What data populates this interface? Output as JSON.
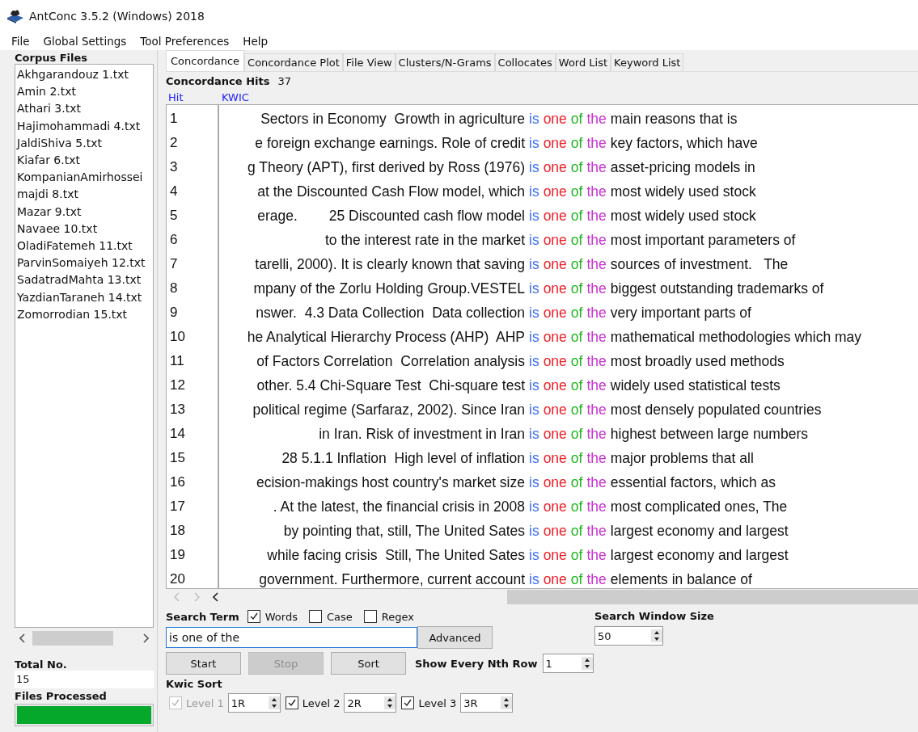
{
  "window": {
    "title": "AntConc 3.5.2 (Windows) 2018"
  },
  "menu": [
    "File",
    "Global Settings",
    "Tool Preferences",
    "Help"
  ],
  "corpus_files": {
    "title": "Corpus Files",
    "items": [
      "Akhgarandouz 1.txt",
      "Amin 2.txt",
      "Athari 3.txt",
      "Hajimohammadi 4.txt",
      "JaldiShiva 5.txt",
      "Kiafar 6.txt",
      "KompanianAmirhossei",
      "majdi 8.txt",
      "Mazar 9.txt",
      "Navaee 10.txt",
      "OladiFatemeh 11.txt",
      "ParvinSomaiyeh 12.txt",
      "SadatradMahta 13.txt",
      "YazdianTaraneh 14.txt",
      "Zomorrodian 15.txt"
    ]
  },
  "total_no": {
    "label": "Total No.",
    "value": "15"
  },
  "files_processed": {
    "label": "Files Processed",
    "level": 1
  },
  "tabs": [
    {
      "label": "Concordance",
      "selected": true
    },
    {
      "label": "Concordance Plot",
      "selected": false
    },
    {
      "label": "File View",
      "selected": false
    },
    {
      "label": "Clusters/N-Grams",
      "selected": false
    },
    {
      "label": "Collocates",
      "selected": false
    },
    {
      "label": "Word List",
      "selected": false
    },
    {
      "label": "Keyword List",
      "selected": false
    }
  ],
  "concordance_hits": {
    "label": "Concordance Hits",
    "value": "37"
  },
  "columns": [
    "Hit",
    "KWIC"
  ],
  "rows": [
    {
      "hit": "1",
      "left": "Sectors in Economy  Growth in agriculture",
      "key": [
        {
          "text": "is",
          "color": "#3c6ef5"
        },
        {
          "text": "one",
          "color": "#f01e28"
        },
        {
          "text": "of",
          "color": "#1eb41e"
        },
        {
          "text": "the",
          "color": "#c832d2"
        }
      ],
      "right": "main reasons that is"
    },
    {
      "hit": "2",
      "left": "e foreign exchange earnings. Role of credit",
      "key": [
        {
          "text": "is",
          "color": "#3c6ef5"
        },
        {
          "text": "one",
          "color": "#f01e28"
        },
        {
          "text": "of",
          "color": "#1eb41e"
        },
        {
          "text": "the",
          "color": "#c832d2"
        }
      ],
      "right": "key factors, which have"
    },
    {
      "hit": "3",
      "left": "g Theory (APT), first derived by Ross (1976)",
      "key": [
        {
          "text": "is",
          "color": "#3c6ef5"
        },
        {
          "text": "one",
          "color": "#f01e28"
        },
        {
          "text": "of",
          "color": "#1eb41e"
        },
        {
          "text": "the",
          "color": "#c832d2"
        }
      ],
      "right": "asset-pricing models in"
    },
    {
      "hit": "4",
      "left": "at the Discounted Cash Flow model, which",
      "key": [
        {
          "text": "is",
          "color": "#3c6ef5"
        },
        {
          "text": "one",
          "color": "#f01e28"
        },
        {
          "text": "of",
          "color": "#1eb41e"
        },
        {
          "text": "the",
          "color": "#c832d2"
        }
      ],
      "right": "most widely used stock"
    },
    {
      "hit": "5",
      "left": "erage.        25 Discounted cash flow model",
      "key": [
        {
          "text": "is",
          "color": "#3c6ef5"
        },
        {
          "text": "one",
          "color": "#f01e28"
        },
        {
          "text": "of",
          "color": "#1eb41e"
        },
        {
          "text": "the",
          "color": "#c832d2"
        }
      ],
      "right": "most widely used stock"
    },
    {
      "hit": "6",
      "left": "to the interest rate in the market",
      "key": [
        {
          "text": "is",
          "color": "#3c6ef5"
        },
        {
          "text": "one",
          "color": "#f01e28"
        },
        {
          "text": "of",
          "color": "#1eb41e"
        },
        {
          "text": "the",
          "color": "#c832d2"
        }
      ],
      "right": "most important parameters of"
    },
    {
      "hit": "7",
      "left": "tarelli, 2000). It is clearly known that saving",
      "key": [
        {
          "text": "is",
          "color": "#3c6ef5"
        },
        {
          "text": "one",
          "color": "#f01e28"
        },
        {
          "text": "of",
          "color": "#1eb41e"
        },
        {
          "text": "the",
          "color": "#c832d2"
        }
      ],
      "right": "sources of investment.   The"
    },
    {
      "hit": "8",
      "left": "mpany of the Zorlu Holding Group.VESTEL",
      "key": [
        {
          "text": "is",
          "color": "#3c6ef5"
        },
        {
          "text": "one",
          "color": "#f01e28"
        },
        {
          "text": "of",
          "color": "#1eb41e"
        },
        {
          "text": "the",
          "color": "#c832d2"
        }
      ],
      "right": "biggest outstanding trademarks of"
    },
    {
      "hit": "9",
      "left": "nswer.  4.3 Data Collection  Data collection",
      "key": [
        {
          "text": "is",
          "color": "#3c6ef5"
        },
        {
          "text": "one",
          "color": "#f01e28"
        },
        {
          "text": "of",
          "color": "#1eb41e"
        },
        {
          "text": "the",
          "color": "#c832d2"
        }
      ],
      "right": "very important parts of"
    },
    {
      "hit": "10",
      "left": "he Analytical Hierarchy Process (AHP)  AHP",
      "key": [
        {
          "text": "is",
          "color": "#3c6ef5"
        },
        {
          "text": "one",
          "color": "#f01e28"
        },
        {
          "text": "of",
          "color": "#1eb41e"
        },
        {
          "text": "the",
          "color": "#c832d2"
        }
      ],
      "right": "mathematical methodologies which may"
    },
    {
      "hit": "11",
      "left": "of Factors Correlation  Correlation analysis",
      "key": [
        {
          "text": "is",
          "color": "#3c6ef5"
        },
        {
          "text": "one",
          "color": "#f01e28"
        },
        {
          "text": "of",
          "color": "#1eb41e"
        },
        {
          "text": "the",
          "color": "#c832d2"
        }
      ],
      "right": "most broadly used methods"
    },
    {
      "hit": "12",
      "left": "other. 5.4 Chi-Square Test  Chi-square test",
      "key": [
        {
          "text": "is",
          "color": "#3c6ef5"
        },
        {
          "text": "one",
          "color": "#f01e28"
        },
        {
          "text": "of",
          "color": "#1eb41e"
        },
        {
          "text": "the",
          "color": "#c832d2"
        }
      ],
      "right": "widely used statistical tests"
    },
    {
      "hit": "13",
      "left": "political regime (Sarfaraz, 2002). Since Iran",
      "key": [
        {
          "text": "is",
          "color": "#3c6ef5"
        },
        {
          "text": "one",
          "color": "#f01e28"
        },
        {
          "text": "of",
          "color": "#1eb41e"
        },
        {
          "text": "the",
          "color": "#c832d2"
        }
      ],
      "right": "most densely populated countries"
    },
    {
      "hit": "14",
      "left": "in Iran. Risk of investment in Iran",
      "key": [
        {
          "text": "is",
          "color": "#3c6ef5"
        },
        {
          "text": "one",
          "color": "#f01e28"
        },
        {
          "text": "of",
          "color": "#1eb41e"
        },
        {
          "text": "the",
          "color": "#c832d2"
        }
      ],
      "right": "highest between large numbers"
    },
    {
      "hit": "15",
      "left": "28 5.1.1 Inflation  High level of inflation",
      "key": [
        {
          "text": "is",
          "color": "#3c6ef5"
        },
        {
          "text": "one",
          "color": "#f01e28"
        },
        {
          "text": "of",
          "color": "#1eb41e"
        },
        {
          "text": "the",
          "color": "#c832d2"
        }
      ],
      "right": "major problems that all"
    },
    {
      "hit": "16",
      "left": "ecision-makings host country's market size",
      "key": [
        {
          "text": "is",
          "color": "#3c6ef5"
        },
        {
          "text": "one",
          "color": "#f01e28"
        },
        {
          "text": "of",
          "color": "#1eb41e"
        },
        {
          "text": "the",
          "color": "#c832d2"
        }
      ],
      "right": "essential factors, which as"
    },
    {
      "hit": "17",
      "left": ". At the latest, the financial crisis in 2008",
      "key": [
        {
          "text": "is",
          "color": "#3c6ef5"
        },
        {
          "text": "one",
          "color": "#f01e28"
        },
        {
          "text": "of",
          "color": "#1eb41e"
        },
        {
          "text": "the",
          "color": "#c832d2"
        }
      ],
      "right": "most complicated ones, The"
    },
    {
      "hit": "18",
      "left": "by pointing that, still, The United Sates",
      "key": [
        {
          "text": "is",
          "color": "#3c6ef5"
        },
        {
          "text": "one",
          "color": "#f01e28"
        },
        {
          "text": "of",
          "color": "#1eb41e"
        },
        {
          "text": "the",
          "color": "#c832d2"
        }
      ],
      "right": "largest economy and largest"
    },
    {
      "hit": "19",
      "left": "while facing crisis  Still, The United Sates",
      "key": [
        {
          "text": "is",
          "color": "#3c6ef5"
        },
        {
          "text": "one",
          "color": "#f01e28"
        },
        {
          "text": "of",
          "color": "#1eb41e"
        },
        {
          "text": "the",
          "color": "#c832d2"
        }
      ],
      "right": "largest economy and largest"
    },
    {
      "hit": "20",
      "left": "government. Furthermore, current account",
      "key": [
        {
          "text": "is",
          "color": "#3c6ef5"
        },
        {
          "text": "one",
          "color": "#f01e28"
        },
        {
          "text": "of",
          "color": "#1eb41e"
        },
        {
          "text": "the",
          "color": "#c832d2"
        }
      ],
      "right": "elements in balance of"
    }
  ],
  "search_term": {
    "label": "Search Term",
    "options": [
      {
        "label": "Words",
        "checked": true
      },
      {
        "label": "Case",
        "checked": false
      },
      {
        "label": "Regex",
        "checked": false
      }
    ],
    "value": "is one of the",
    "advanced": "Advanced"
  },
  "search_window_size": {
    "label": "Search Window Size",
    "value": "50"
  },
  "buttons": [
    {
      "label": "Start",
      "disabled": false
    },
    {
      "label": "Stop",
      "disabled": true
    },
    {
      "label": "Sort",
      "disabled": false
    }
  ],
  "show_every_nth_row": {
    "label": "Show Every Nth Row",
    "value": "1"
  },
  "kwic_sort": {
    "label": "Kwic Sort",
    "levels": [
      {
        "label": "Level 1",
        "checked": true,
        "disabled": true,
        "value": "1R"
      },
      {
        "label": "Level 2",
        "checked": true,
        "disabled": false,
        "value": "2R"
      },
      {
        "label": "Level 3",
        "checked": true,
        "disabled": false,
        "value": "3R"
      }
    ]
  }
}
